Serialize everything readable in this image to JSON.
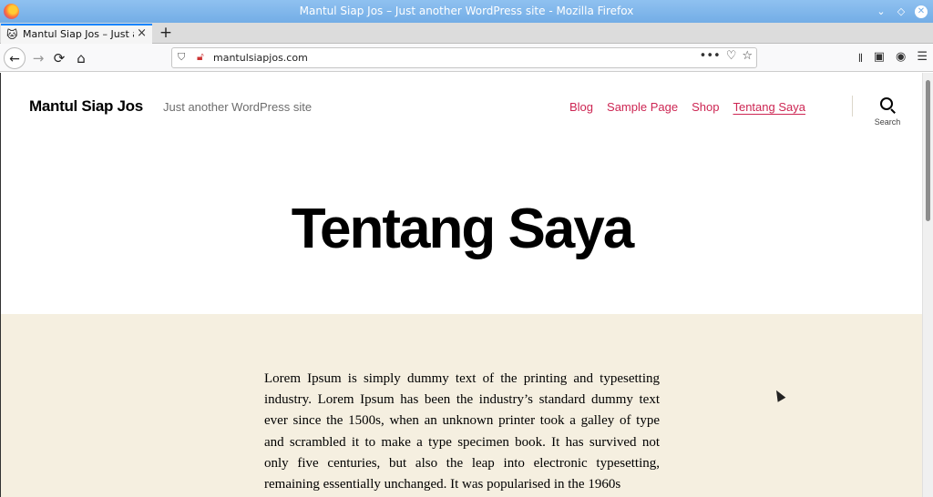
{
  "window": {
    "title": "Mantul Siap Jos – Just another WordPress site - Mozilla Firefox",
    "controls": [
      "chevron-down",
      "restore",
      "close"
    ]
  },
  "tab": {
    "label": "Mantul Siap Jos – Just another",
    "favicon": "🐱",
    "close": "×"
  },
  "toolbar": {
    "new_tab": "+",
    "back": "←",
    "forward": "→",
    "reload": "⟳",
    "home": "⌂",
    "url": "mantulsiapjos.com",
    "page_actions": "•••"
  },
  "site": {
    "title": "Mantul Siap Jos",
    "description": "Just another WordPress site",
    "nav": [
      "Blog",
      "Sample Page",
      "Shop",
      "Tentang Saya"
    ],
    "current_nav": "Tentang Saya",
    "search_label": "Search",
    "accent_color": "#cd2653",
    "content_bg_color": "#f5efe0"
  },
  "entry": {
    "title": "Tentang Saya",
    "content": "Lorem Ipsum is simply dummy text of the printing and typesetting industry. Lorem Ipsum has been the industry’s standard dummy text ever since the 1500s, when an unknown printer took a galley of type and scrambled it to make a type specimen book. It has survived not only five centuries, but also the leap into electronic typesetting, remaining essentially unchanged. It was popularised in the 1960s"
  }
}
